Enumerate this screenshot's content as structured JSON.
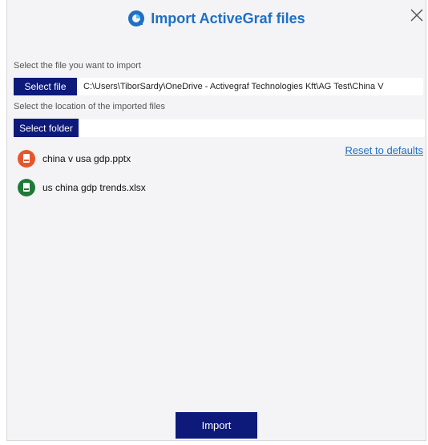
{
  "dialog": {
    "title": "Import ActiveGraf files",
    "close_icon": "close-icon",
    "logo_icon": "activegraf-logo-icon"
  },
  "file_section": {
    "label": "Select the file you want to import",
    "button_label": "Select file",
    "path_value": "C:\\Users\\TiborSardy\\OneDrive - Activegraf Technologies Kft\\AG Test\\China V"
  },
  "folder_section": {
    "label": "Select the location of the imported files",
    "button_label": "Select folder",
    "path_value": ""
  },
  "reset_link": "Reset to defaults",
  "files": [
    {
      "name": "china v usa gdp.pptx",
      "icon": "powerpoint-file-icon",
      "color": "#e4572e"
    },
    {
      "name": "us china gdp trends.xlsx",
      "icon": "excel-file-icon",
      "color": "#1f7a3a"
    }
  ],
  "import_button": "Import",
  "colors": {
    "accent": "#1f6fc5",
    "button_dark": "#0d1a7a",
    "background": "#f4f4f6"
  }
}
